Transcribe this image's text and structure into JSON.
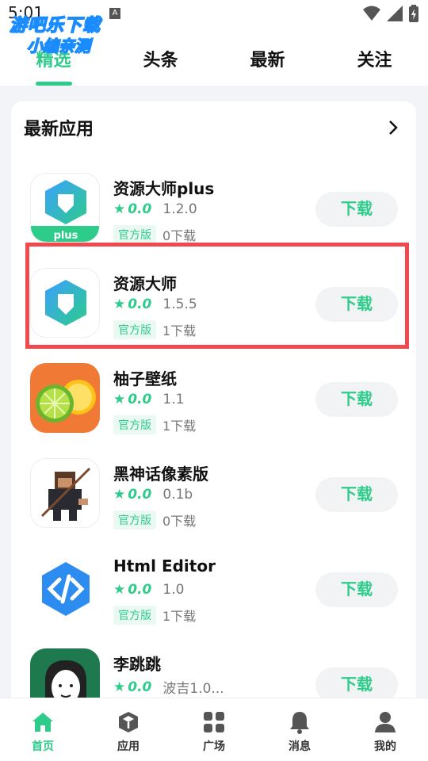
{
  "status_bar": {
    "time": "5:01",
    "indicator": "A"
  },
  "watermark": {
    "line1": "游吧乐下载",
    "line2": "小编亲测"
  },
  "top_tabs": [
    {
      "label": "精选",
      "active": true
    },
    {
      "label": "头条",
      "active": false
    },
    {
      "label": "最新",
      "active": false
    },
    {
      "label": "关注",
      "active": false
    }
  ],
  "section": {
    "title": "最新应用"
  },
  "apps": [
    {
      "name": "资源大师plus",
      "score": "0.0",
      "version": "1.2.0",
      "badge": "官方版",
      "downloads": "0下载",
      "button": "下载",
      "icon_text": "plus"
    },
    {
      "name": "资源大师",
      "score": "0.0",
      "version": "1.5.5",
      "badge": "官方版",
      "downloads": "1下载",
      "button": "下载"
    },
    {
      "name": "柚子壁纸",
      "score": "0.0",
      "version": "1.1",
      "badge": "官方版",
      "downloads": "1下载",
      "button": "下载"
    },
    {
      "name": "黑神话像素版",
      "score": "0.0",
      "version": "0.1b",
      "badge": "官方版",
      "downloads": "0下载",
      "button": "下载"
    },
    {
      "name": "Html Editor",
      "score": "0.0",
      "version": "1.0",
      "badge": "官方版",
      "downloads": "1下载",
      "button": "下载"
    },
    {
      "name": "李跳跳",
      "score": "0.0",
      "version": "波吉1.0...",
      "button": "下载"
    }
  ],
  "bottom_nav": [
    {
      "label": "首页",
      "icon": "home-icon",
      "active": true
    },
    {
      "label": "应用",
      "icon": "cube-icon",
      "active": false
    },
    {
      "label": "广场",
      "icon": "grid-icon",
      "active": false
    },
    {
      "label": "消息",
      "icon": "bell-icon",
      "active": false
    },
    {
      "label": "我的",
      "icon": "user-icon",
      "active": false
    }
  ],
  "colors": {
    "accent": "#2ecc8a",
    "highlight_border": "#f04a4f"
  }
}
